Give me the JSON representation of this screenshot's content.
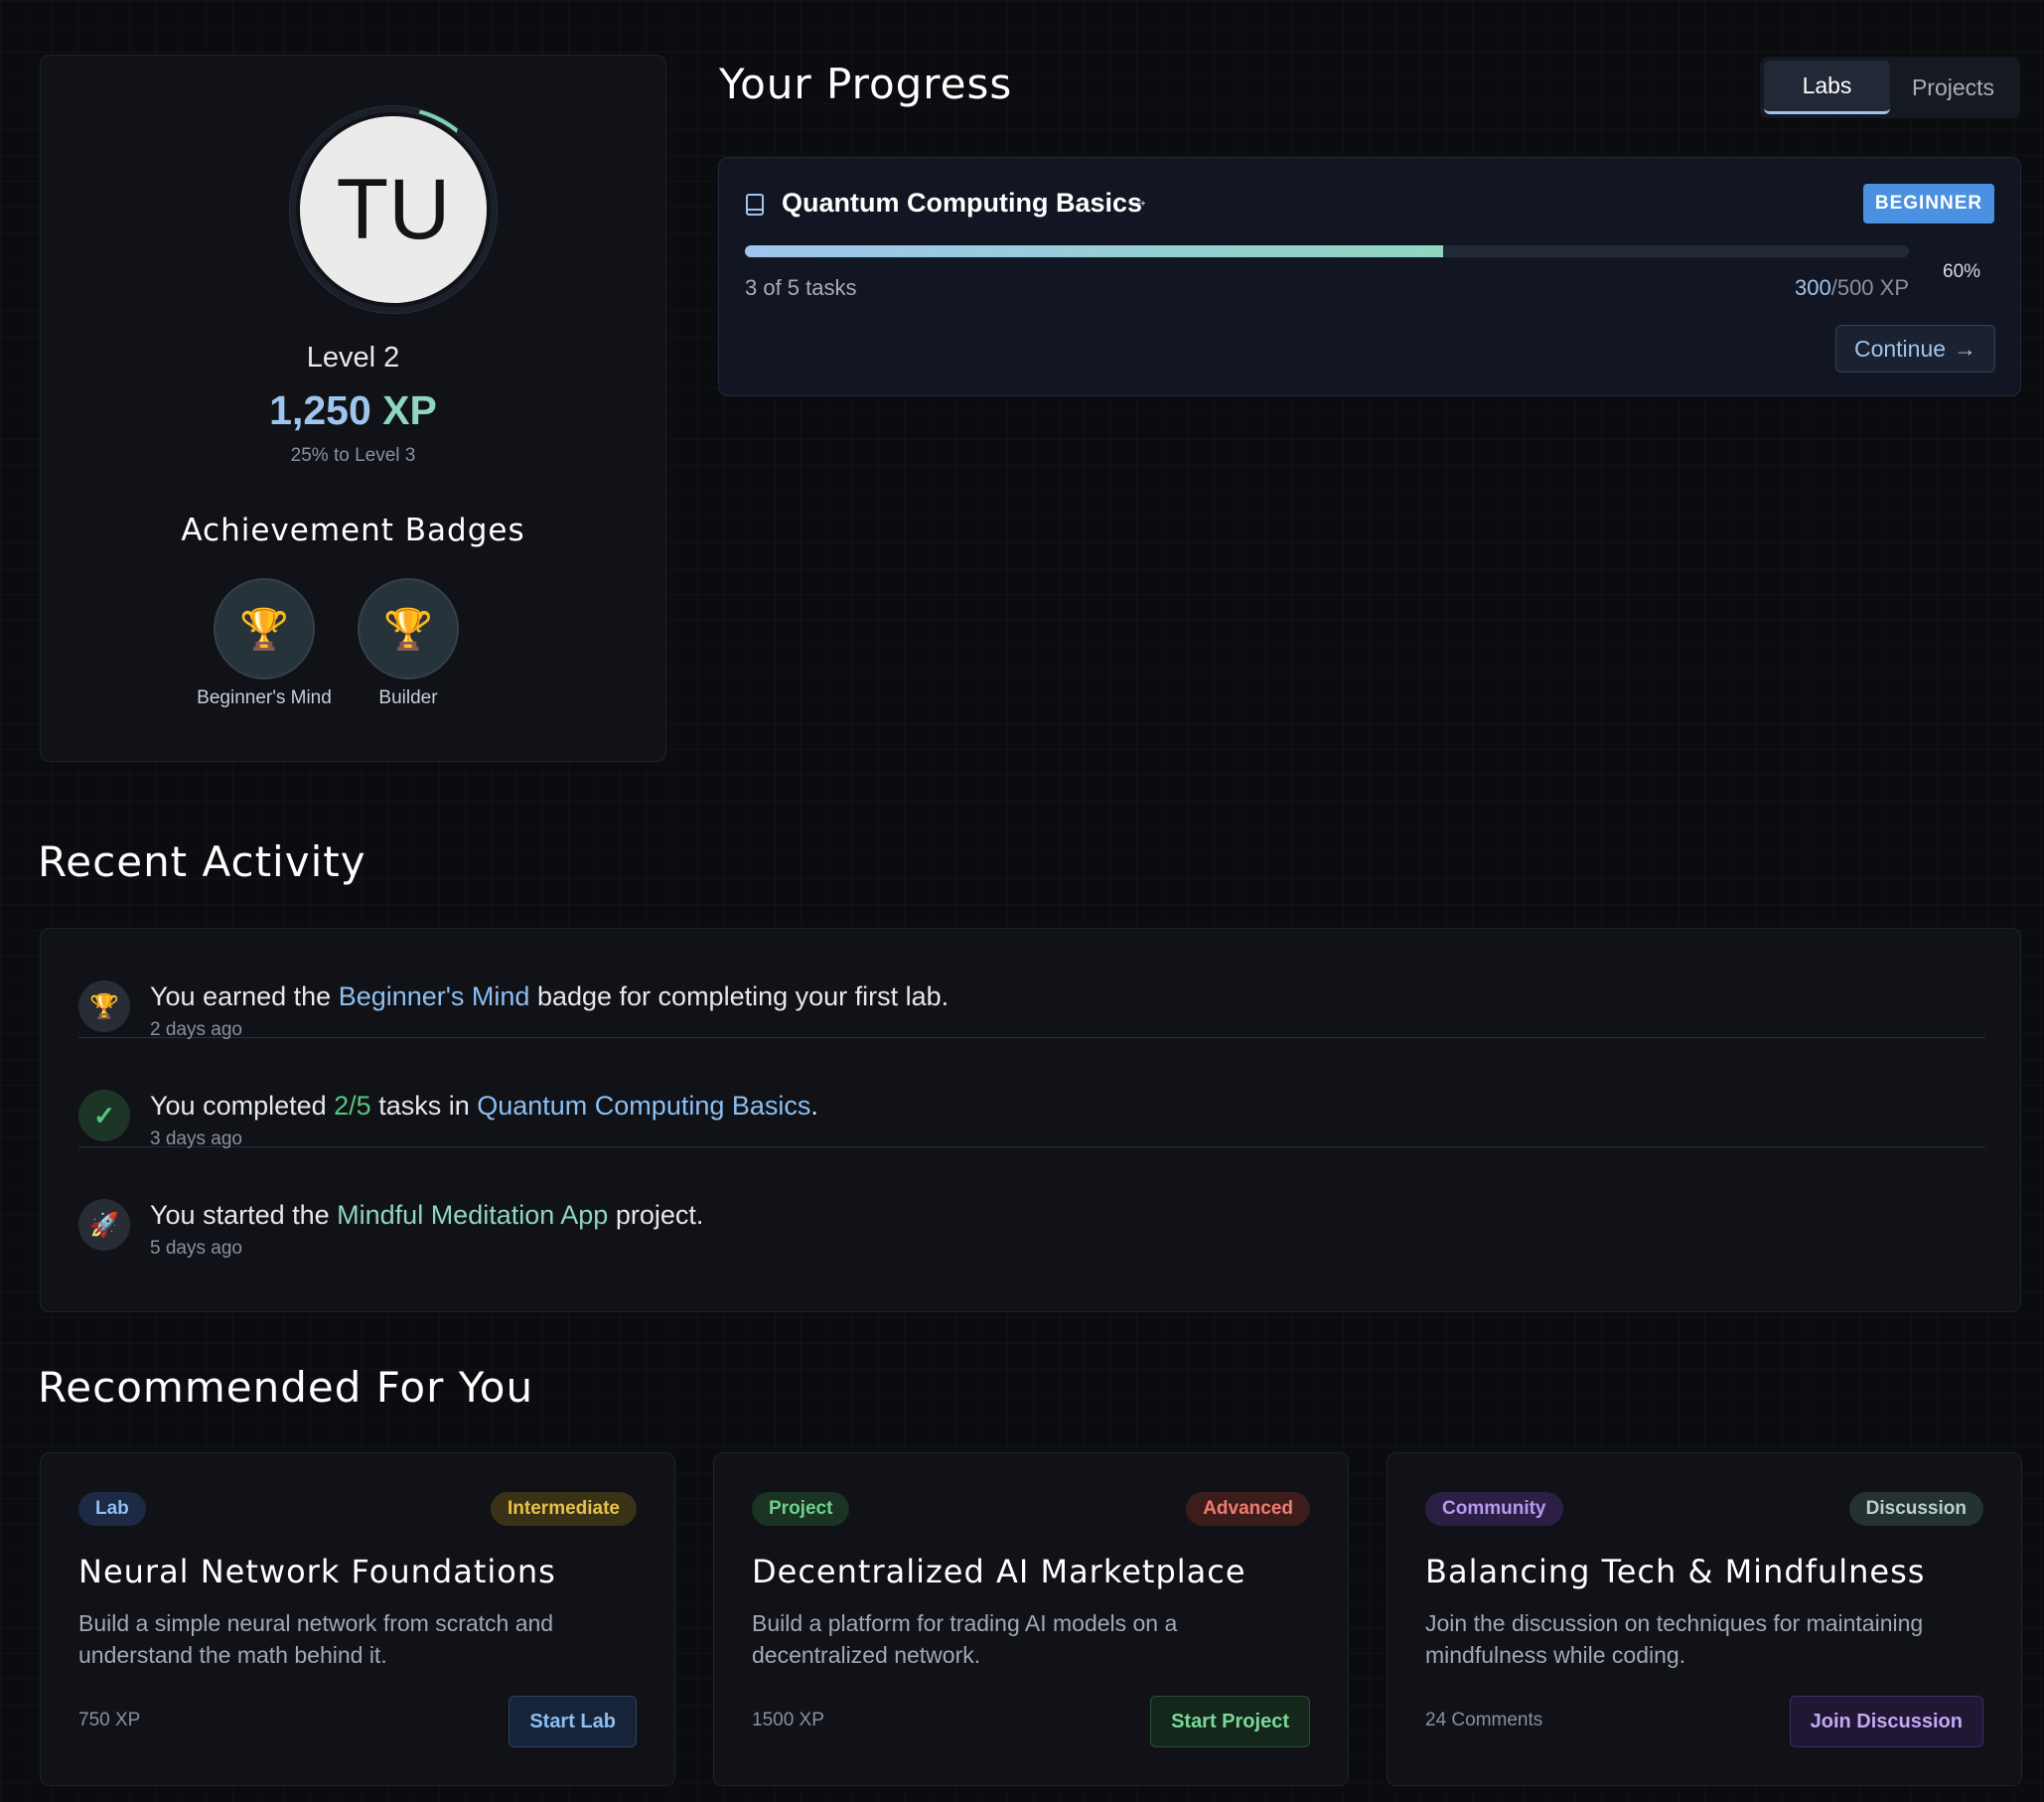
{
  "profile": {
    "avatar_initials": "TU",
    "level": "Level 2",
    "xp_value": "1,250",
    "xp_unit": "XP",
    "to_next_level": "25% to Level 3",
    "badges_title": "Achievement Badges",
    "badges": [
      {
        "label": "Beginner's Mind",
        "icon": "trophy-icon",
        "glyph": "🏆"
      },
      {
        "label": "Builder",
        "icon": "trophy-icon",
        "glyph": "🏆"
      }
    ]
  },
  "progress": {
    "title": "Your Progress",
    "tabs": [
      {
        "label": "Labs",
        "active": true
      },
      {
        "label": "Projects",
        "active": false
      }
    ],
    "course": {
      "name": "Quantum Computing Basics",
      "arrow": "→",
      "level": "BEGINNER",
      "progress_fraction": 0.6,
      "tasks": "3 of 5 tasks",
      "xp_current": "300",
      "xp_total": "/500 XP",
      "percent": "60%",
      "continue_label": "Continue",
      "continue_arrow": "→"
    }
  },
  "recent": {
    "title": "Recent Activity",
    "items": [
      {
        "icon": "trophy-icon",
        "glyph": "🏆",
        "pre": "You earned the ",
        "highlight": "Beginner's Mind",
        "post": " badge for completing your first lab.",
        "time": "2 days ago"
      },
      {
        "icon": "check-icon",
        "glyph": "✓",
        "pre": "You completed ",
        "count": "2/5",
        "mid": " tasks in ",
        "highlight": "Quantum Computing Basics",
        "post": ".",
        "time": "3 days ago"
      },
      {
        "icon": "rocket-icon",
        "glyph": "🚀",
        "pre": "You started the ",
        "highlight": "Mindful Meditation App",
        "post": " project.",
        "time": "5 days ago"
      }
    ]
  },
  "recommended": {
    "title": "Recommended For You",
    "cards": [
      {
        "type": "Lab",
        "tag": "Intermediate",
        "name": "Neural Network Foundations",
        "desc": "Build a simple neural network from scratch and understand the math behind it.",
        "meta": "750 XP",
        "button": "Start Lab"
      },
      {
        "type": "Project",
        "tag": "Advanced",
        "name": "Decentralized AI Marketplace",
        "desc": "Build a platform for trading AI models on a decentralized network.",
        "meta": "1500 XP",
        "button": "Start Project"
      },
      {
        "type": "Community",
        "tag": "Discussion",
        "name": "Balancing Tech & Mindfulness",
        "desc": "Join the discussion on techniques for maintaining mindfulness while coding.",
        "meta": "24 Comments",
        "button": "Join Discussion"
      }
    ]
  },
  "colors": {
    "accent_blue": "#9fc5ef",
    "accent_green": "#8fd6bf",
    "beginner_pill": "#4a91e2",
    "success_green": "#57c77d"
  }
}
